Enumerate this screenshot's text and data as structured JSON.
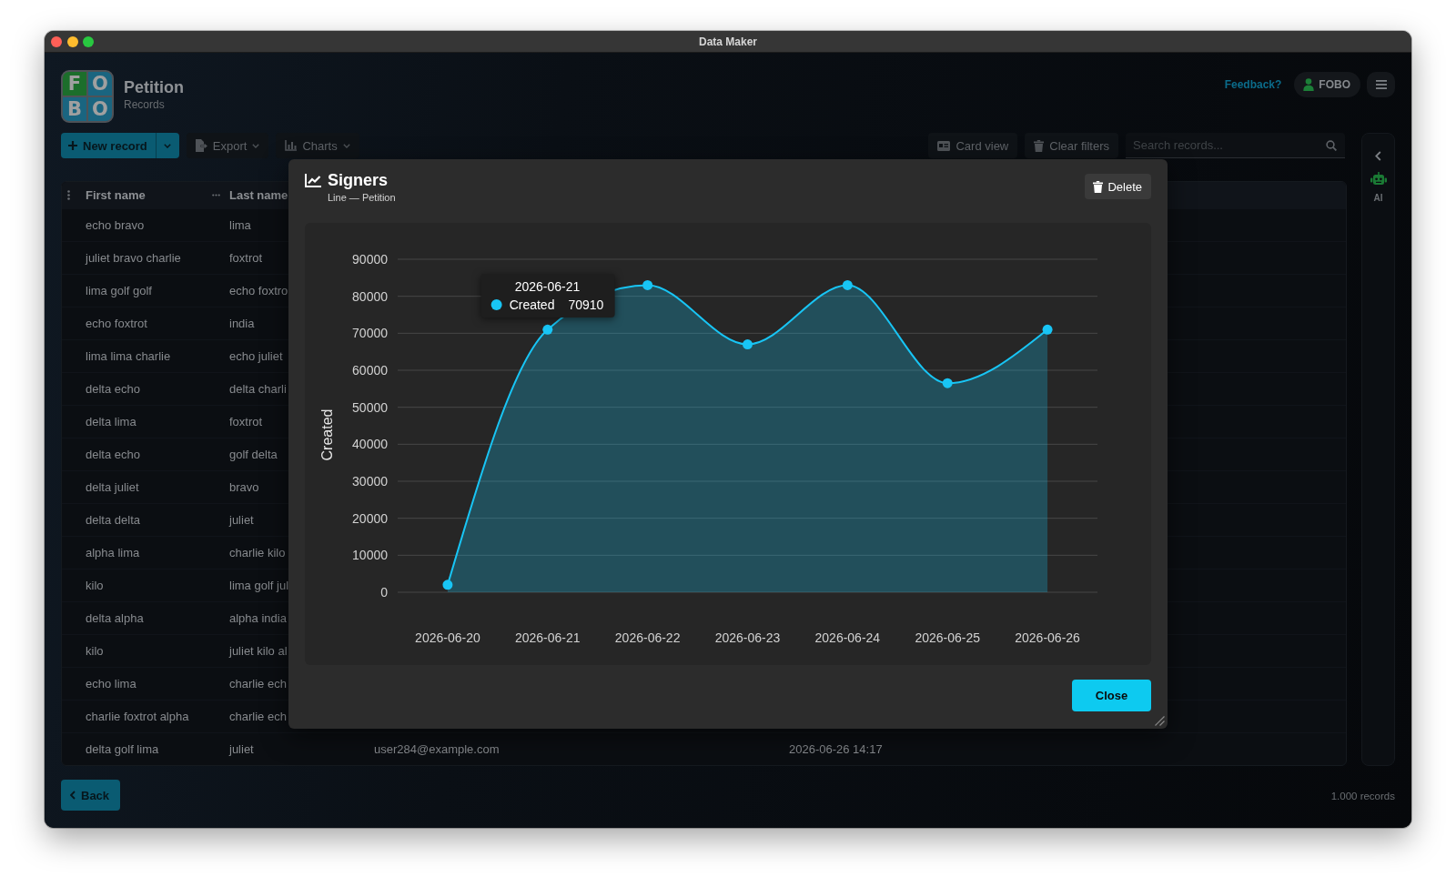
{
  "window": {
    "title": "Data Maker"
  },
  "header": {
    "logo": {
      "letters": [
        "F",
        "O",
        "B",
        "O"
      ]
    },
    "title": "Petition",
    "subtitle": "Records",
    "feedback_link": "Feedback?",
    "user_button": "FOBO"
  },
  "toolbar": {
    "new_record": "New record",
    "export": "Export",
    "charts": "Charts",
    "card_view": "Card view",
    "clear_filters": "Clear filters",
    "search": {
      "placeholder": "Search records..."
    }
  },
  "ai_panel": {
    "label": "AI"
  },
  "table": {
    "columns": [
      "First name",
      "Last name"
    ],
    "rows": [
      {
        "cells": [
          "echo bravo",
          "lima"
        ]
      },
      {
        "cells": [
          "juliet bravo charlie",
          "foxtrot"
        ]
      },
      {
        "cells": [
          "lima golf golf",
          "echo foxtro"
        ]
      },
      {
        "cells": [
          "echo foxtrot",
          "india"
        ]
      },
      {
        "cells": [
          "lima lima charlie",
          "echo juliet"
        ]
      },
      {
        "cells": [
          "delta echo",
          "delta charli"
        ]
      },
      {
        "cells": [
          "delta lima",
          "foxtrot"
        ]
      },
      {
        "cells": [
          "delta echo",
          "golf delta"
        ]
      },
      {
        "cells": [
          "delta juliet",
          "bravo"
        ]
      },
      {
        "cells": [
          "delta delta",
          "juliet"
        ]
      },
      {
        "cells": [
          "alpha lima",
          "charlie kilo"
        ]
      },
      {
        "cells": [
          "kilo",
          "lima golf jul"
        ]
      },
      {
        "cells": [
          "delta alpha",
          "alpha india"
        ]
      },
      {
        "cells": [
          "kilo",
          "juliet kilo al"
        ]
      },
      {
        "cells": [
          "echo lima",
          "charlie ech"
        ]
      },
      {
        "cells": [
          "charlie foxtrot alpha",
          "charlie ech"
        ]
      },
      {
        "cells": [
          "delta golf lima",
          "juliet",
          "user284@example.com",
          "2026-06-26 14:17"
        ]
      }
    ]
  },
  "footer": {
    "back_button": "Back",
    "record_count": "1.000 records"
  },
  "modal": {
    "title": "Signers",
    "subtitle": "Line — Petition",
    "delete_button": "Delete",
    "close_button": "Close",
    "chart_data": {
      "type": "area",
      "ylabel": "Created",
      "categories": [
        "2026-06-20",
        "2026-06-21",
        "2026-06-22",
        "2026-06-23",
        "2026-06-24",
        "2026-06-25",
        "2026-06-26"
      ],
      "values": [
        2000,
        71000,
        83000,
        67000,
        83000,
        56500,
        71000
      ],
      "color": "#18c5f5",
      "ylim": [
        0,
        90000
      ],
      "yticks": [
        0,
        10000,
        20000,
        30000,
        40000,
        50000,
        60000,
        70000,
        80000,
        90000
      ],
      "grid": true,
      "marker": "circle"
    },
    "tooltip": {
      "title": "2026-06-21",
      "label": "Created",
      "value": "70910"
    }
  }
}
